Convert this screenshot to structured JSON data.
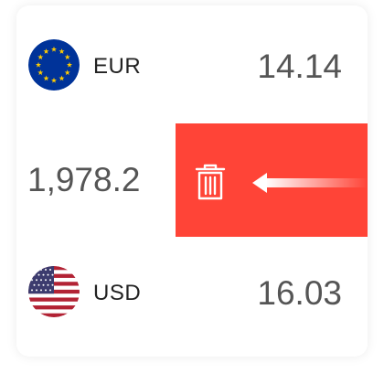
{
  "rows": [
    {
      "code": "EUR",
      "amount": "14.14",
      "flag_icon": "eu-flag-icon"
    },
    {
      "amount": "1,978.2",
      "action_icon": "trash-icon",
      "action": "delete",
      "action_color": "#ff4437"
    },
    {
      "code": "USD",
      "amount": "16.03",
      "flag_icon": "us-flag-icon"
    }
  ],
  "colors": {
    "delete_background": "#ff4437",
    "amount_text": "#555555",
    "code_text": "#222222",
    "divider": "#ececec",
    "eu_blue": "#003399",
    "eu_star": "#ffcc00",
    "us_red": "#b22234",
    "us_blue": "#3c3b6e"
  }
}
